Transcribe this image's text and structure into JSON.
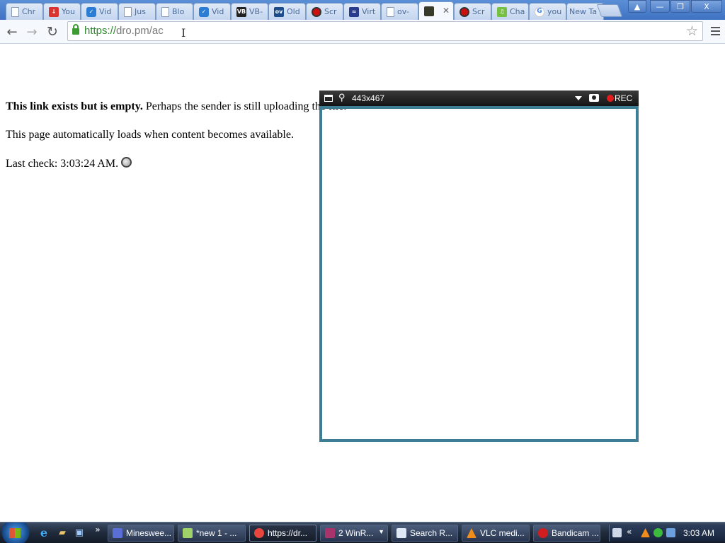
{
  "browser": {
    "tabs": [
      {
        "label": "Chr",
        "icon": "document-icon",
        "active": false
      },
      {
        "label": "You",
        "icon": "download-icon",
        "active": false
      },
      {
        "label": "Vid",
        "icon": "checkmark-icon",
        "active": false
      },
      {
        "label": "Jus",
        "icon": "document-icon",
        "active": false
      },
      {
        "label": "Blo",
        "icon": "document-icon",
        "active": false
      },
      {
        "label": "Vid",
        "icon": "checkmark-icon",
        "active": false
      },
      {
        "label": "VB-",
        "icon": "vb-icon",
        "active": false
      },
      {
        "label": "Old",
        "icon": "ov-icon",
        "active": false
      },
      {
        "label": "Scr",
        "icon": "record-icon",
        "active": false
      },
      {
        "label": "Virt",
        "icon": "wave-icon",
        "active": false
      },
      {
        "label": "ov-",
        "icon": "document-icon",
        "active": false
      },
      {
        "label": "",
        "icon": "gallery-icon",
        "active": true
      },
      {
        "label": "Scr",
        "icon": "record-icon",
        "active": false
      },
      {
        "label": "Cha",
        "icon": "music-icon",
        "active": false
      },
      {
        "label": "you",
        "icon": "google-icon",
        "active": false
      },
      {
        "label": "New Ta",
        "icon": "none",
        "active": false
      }
    ],
    "url": {
      "scheme": "https://",
      "rest": "dro.pm/ac"
    },
    "window_controls": {
      "user": "▲",
      "minimize": "—",
      "maximize": "❐",
      "close": "X"
    }
  },
  "page": {
    "message_bold": "This link exists but is empty.",
    "message_rest": " Perhaps the sender is still uploading the file.",
    "autoload_text": "This page automatically loads when content becomes available.",
    "last_check": "Last check: 3:03:24 AM."
  },
  "capture_overlay": {
    "size": "443x467",
    "rec_label": "REC",
    "frame_color": "#3e7d96"
  },
  "taskbar": {
    "items": [
      {
        "label": "Mineswee...",
        "icon": "minesweeper-icon",
        "color": "#5a6fd6"
      },
      {
        "label": "*new 1 - ...",
        "icon": "notepad-icon",
        "color": "#9fd36a"
      },
      {
        "label": "https://dr...",
        "icon": "chrome-icon",
        "color": "#e8453c",
        "active": true
      },
      {
        "label": "2 WinR...",
        "icon": "winrar-icon",
        "color": "#a9336b"
      },
      {
        "label": "Search R...",
        "icon": "document-icon",
        "color": "#dfe8f5"
      },
      {
        "label": "VLC medi...",
        "icon": "vlc-icon",
        "color": "#f08c1c"
      },
      {
        "label": "Bandicam ...",
        "icon": "bandicam-icon",
        "color": "#d11d1d"
      }
    ],
    "clock": "3:03 AM",
    "tray_chevron": "«"
  }
}
